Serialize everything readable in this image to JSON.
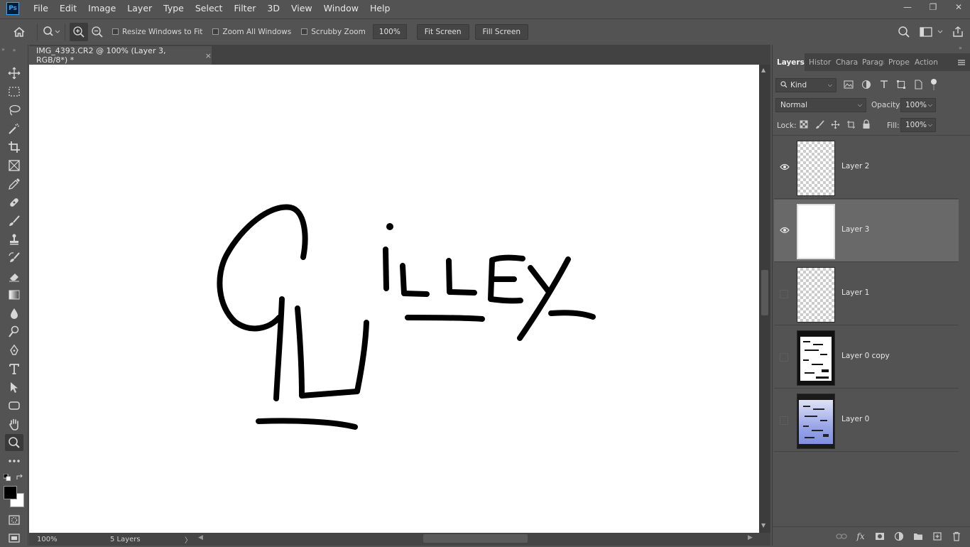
{
  "app": {
    "logo_text": "Ps"
  },
  "menu": [
    "File",
    "Edit",
    "Image",
    "Layer",
    "Type",
    "Select",
    "Filter",
    "3D",
    "View",
    "Window",
    "Help"
  ],
  "window_controls": {
    "minimize": "—",
    "restore": "❐",
    "close": "✕"
  },
  "options": {
    "resize_windows": "Resize Windows to Fit",
    "zoom_all": "Zoom All Windows",
    "scrubby_zoom": "Scrubby Zoom",
    "zoom_value": "100%",
    "fit_screen": "Fit Screen",
    "fill_screen": "Fill Screen"
  },
  "document": {
    "tab_title": "IMG_4393.CR2 @ 100% (Layer 3, RGB/8*) *",
    "close": "×",
    "status_zoom": "100%",
    "status_info": "5 Layers"
  },
  "panel": {
    "tabs": [
      "Layers",
      "Histor",
      "Chara",
      "Paragr",
      "Prope",
      "Action"
    ],
    "filter_kind": "Kind",
    "blend_mode": "Normal",
    "opacity_label": "Opacity:",
    "opacity_value": "100%",
    "lock_label": "Lock:",
    "fill_label": "Fill:",
    "fill_value": "100%",
    "layers": [
      {
        "name": "Layer 2",
        "visible": true,
        "selected": false
      },
      {
        "name": "Layer 3",
        "visible": true,
        "selected": true
      },
      {
        "name": "Layer 1",
        "visible": false,
        "selected": false
      },
      {
        "name": "Layer 0 copy",
        "visible": false,
        "selected": false
      },
      {
        "name": "Layer 0",
        "visible": false,
        "selected": false
      }
    ]
  }
}
